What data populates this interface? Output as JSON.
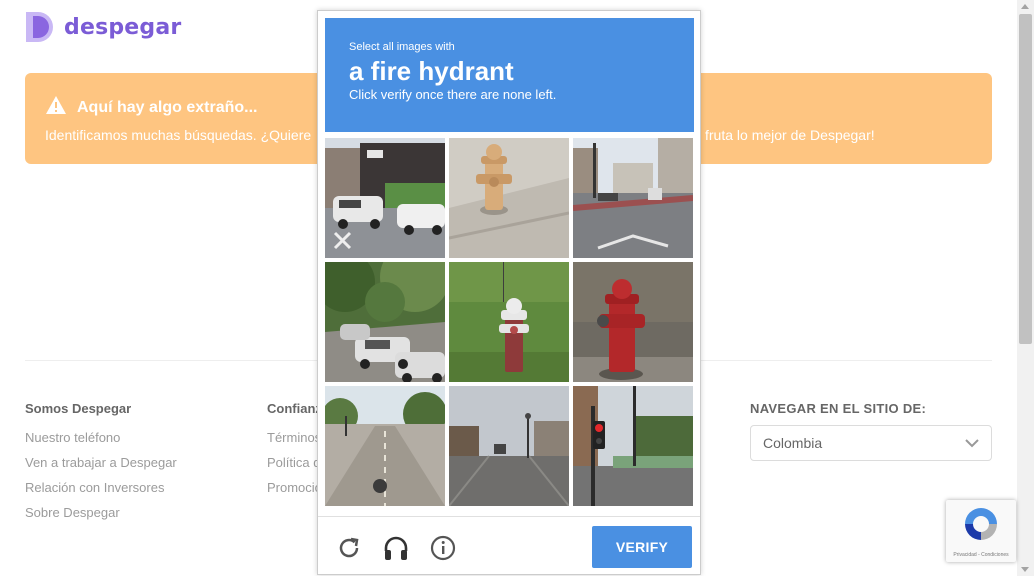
{
  "brand": {
    "name": "despegar",
    "color": "#7b5cd6"
  },
  "alert": {
    "title": "Aquí hay algo extraño...",
    "body_left": "Identificamos muchas búsquedas. ¿Quiere",
    "body_right": "fruta lo mejor de Despegar!",
    "background": "#fec581"
  },
  "footer": {
    "col1": {
      "title": "Somos Despegar",
      "links": [
        "Nuestro teléfono",
        "Ven a trabajar a Despegar",
        "Relación con Inversores",
        "Sobre Despegar"
      ]
    },
    "col2": {
      "title": "Confianz",
      "links": [
        "Términos",
        "Política d",
        "Promocio"
      ]
    },
    "nav": {
      "title": "NAVEGAR EN EL SITIO DE:",
      "selected": "Colombia"
    }
  },
  "captcha": {
    "instruction_small": "Select all images with",
    "target": "a fire hydrant",
    "instruction_sub": "Click verify once there are none left.",
    "verify_label": "VERIFY",
    "accent": "#4a90e2",
    "tiles": [
      {
        "id": 1,
        "icon": "street-cars-tile"
      },
      {
        "id": 2,
        "icon": "fire-hydrant-tile"
      },
      {
        "id": 3,
        "icon": "street-intersection-tile"
      },
      {
        "id": 4,
        "icon": "parked-cars-tile"
      },
      {
        "id": 5,
        "icon": "fire-hydrant-tile"
      },
      {
        "id": 6,
        "icon": "fire-hydrant-tile"
      },
      {
        "id": 7,
        "icon": "road-tile"
      },
      {
        "id": 8,
        "icon": "street-tile"
      },
      {
        "id": 9,
        "icon": "traffic-light-tile"
      }
    ],
    "badge_text": "Privacidad - Condiciones"
  }
}
